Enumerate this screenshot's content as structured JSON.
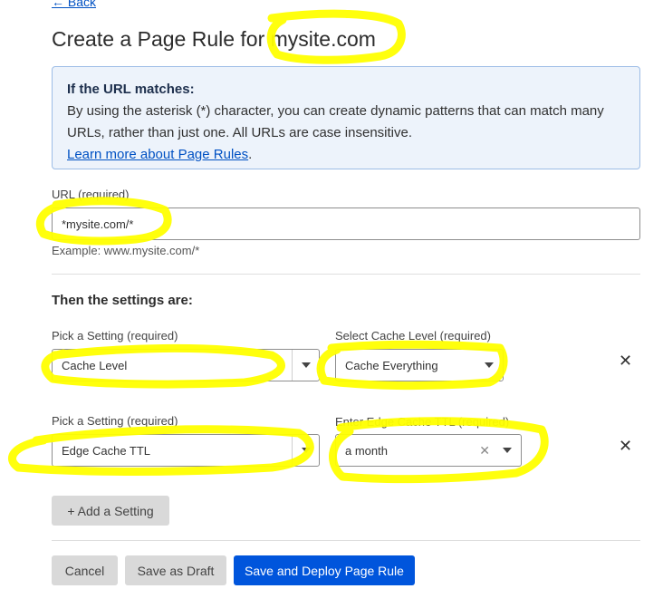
{
  "nav": {
    "back_label": "← Back"
  },
  "page": {
    "title": "Create a Page Rule for mysite.com"
  },
  "info": {
    "heading": "If the URL matches:",
    "body": "By using the asterisk (*) character, you can create dynamic patterns that can match many URLs, rather than just one. All URLs are case insensitive.",
    "link": "Learn more about Page Rules",
    "link_suffix": "."
  },
  "url": {
    "label": "URL (required)",
    "value": "*mysite.com/*",
    "example": "Example: www.mysite.com/*"
  },
  "settings": {
    "heading": "Then the settings are:",
    "rows": [
      {
        "setting_label": "Pick a Setting (required)",
        "setting_value": "Cache Level",
        "option_label": "Select Cache Level (required)",
        "option_value": "Cache Everything"
      },
      {
        "setting_label": "Pick a Setting (required)",
        "setting_value": "Edge Cache TTL",
        "option_label": "Enter Edge Cache TTL (required)",
        "option_value": "a month"
      }
    ],
    "add_label": "+ Add a Setting"
  },
  "actions": {
    "cancel": "Cancel",
    "draft": "Save as Draft",
    "deploy": "Save and Deploy Page Rule"
  },
  "icons": {
    "remove": "close-icon",
    "caret": "chevron-down-icon",
    "clear": "clear-icon"
  },
  "colors": {
    "accent": "#0055dc",
    "link": "#0051c3",
    "info_bg": "#edf3fb",
    "highlight": "#ffff00"
  }
}
